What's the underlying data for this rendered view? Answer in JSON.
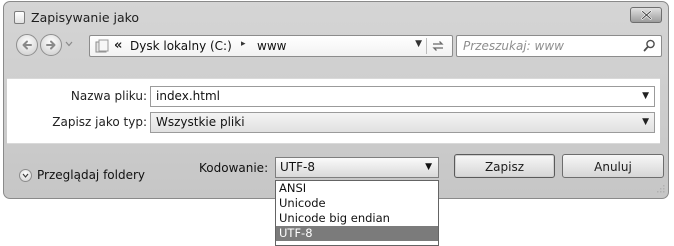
{
  "window": {
    "title": "Zapisywanie jako",
    "close_symbol": "✕"
  },
  "nav": {
    "back_icon": "back-arrow-icon",
    "forward_icon": "forward-arrow-icon",
    "address": {
      "chevron": "«",
      "segments": [
        "Dysk lokalny (C:)",
        "www"
      ],
      "separator": "▸"
    },
    "search_placeholder": "Przeszukaj: www"
  },
  "form": {
    "filename_label": "Nazwa pliku:",
    "filename_value": "index.html",
    "filetype_label": "Zapisz jako typ:",
    "filetype_value": "Wszystkie pliki"
  },
  "footer": {
    "browse_label": "Przeglądaj foldery",
    "encoding_label": "Kodowanie:",
    "encoding_value": "UTF-8",
    "save_label": "Zapisz",
    "cancel_label": "Anuluj"
  },
  "encoding_options": [
    {
      "label": "ANSI",
      "selected": false
    },
    {
      "label": "Unicode",
      "selected": false
    },
    {
      "label": "Unicode big endian",
      "selected": false
    },
    {
      "label": "UTF-8",
      "selected": true
    }
  ],
  "colors": {
    "window_bg": "#cbcbcb",
    "selected_option_bg": "#7b7b7b"
  }
}
